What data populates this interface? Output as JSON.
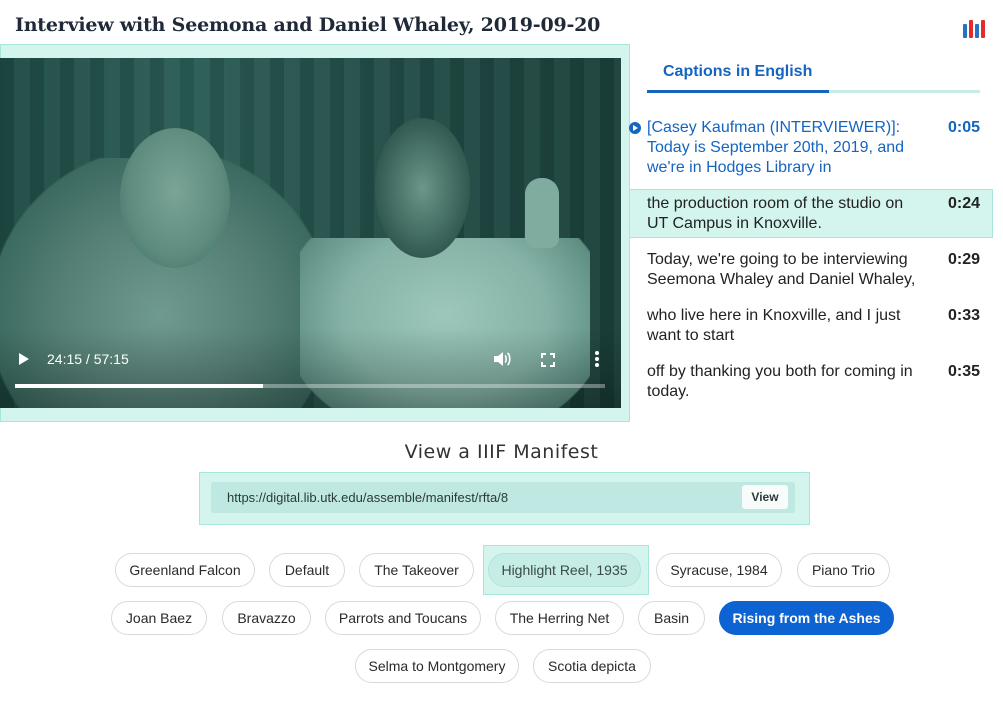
{
  "header": {
    "title": "Interview with Seemona and Daniel Whaley, 2019-09-20",
    "logo_icon": "iiif-logo",
    "logo_colors": [
      "#2872c2",
      "#e42a2a",
      "#2872c2",
      "#e42a2a"
    ]
  },
  "player": {
    "time_display": "24:15 / 57:15",
    "progress_fraction": 0.42,
    "icons": {
      "play": "play-icon",
      "volume": "volume-icon",
      "fullscreen": "fullscreen-icon",
      "more": "more-vertical-icon"
    }
  },
  "captions": {
    "tab_label": "Captions in English",
    "items": [
      {
        "text": "[Casey Kaufman (INTERVIEWER)]: Today is September 20th, 2019, and we're in Hodges Library in",
        "time": "0:05"
      },
      {
        "text": "the production room of the studio on UT Campus in Knoxville.",
        "time": "0:24"
      },
      {
        "text": "Today, we're going to be interviewing Seemona Whaley and Daniel Whaley,",
        "time": "0:29"
      },
      {
        "text": "who live here in Knoxville, and I just want to start",
        "time": "0:33"
      },
      {
        "text": "off by thanking you both for coming in today.",
        "time": "0:35"
      }
    ]
  },
  "manifest": {
    "heading": "View a IIIF Manifest",
    "url": "https://digital.lib.utk.edu/assemble/manifest/rfta/8",
    "button_label": "View"
  },
  "presets": [
    "Greenland Falcon",
    "Default",
    "The Takeover",
    "Highlight Reel, 1935",
    "Syracuse, 1984",
    "Piano Trio",
    "Joan Baez",
    "Bravazzo",
    "Parrots and Toucans",
    "The Herring Net",
    "Basin",
    "Rising from the Ashes",
    "Selma to Montgomery",
    "Scotia depicta"
  ],
  "colors": {
    "accent": "#1565c0",
    "primary_button": "#0d63d1",
    "highlight": "#d4f4ee"
  }
}
